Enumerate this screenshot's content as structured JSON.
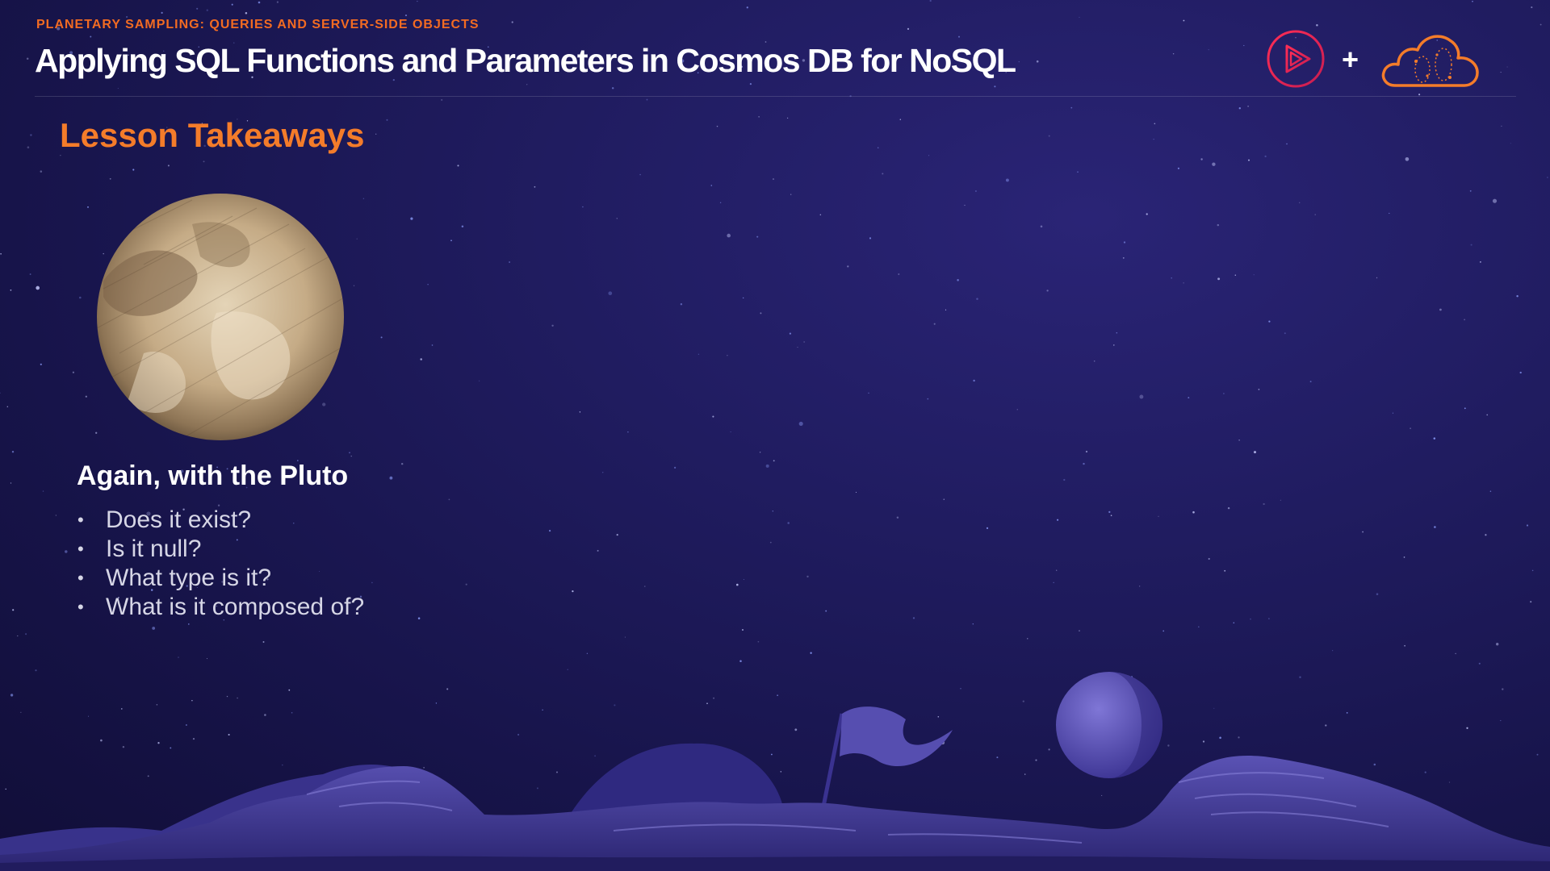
{
  "header": {
    "eyebrow": "PLANETARY SAMPLING: QUERIES AND SERVER-SIDE OBJECTS",
    "title": "Applying SQL Functions and Parameters in Cosmos DB for NoSQL",
    "logos": {
      "left_icon": "play-logo-icon",
      "separator": "+",
      "right_icon": "cloud-logo-icon"
    }
  },
  "content": {
    "section_heading": "Lesson Takeaways",
    "image_icon": "pluto-planet-image",
    "subheading": "Again, with the Pluto",
    "bullets": [
      "Does it exist?",
      "Is it null?",
      "What type is it?",
      "What is it composed of?"
    ]
  },
  "colors": {
    "accent_orange": "#f47c2a",
    "eyebrow_orange": "#f26b22",
    "logo_pink": "#e8255c",
    "background": "#1c1858",
    "terrain": "#3d3590"
  }
}
